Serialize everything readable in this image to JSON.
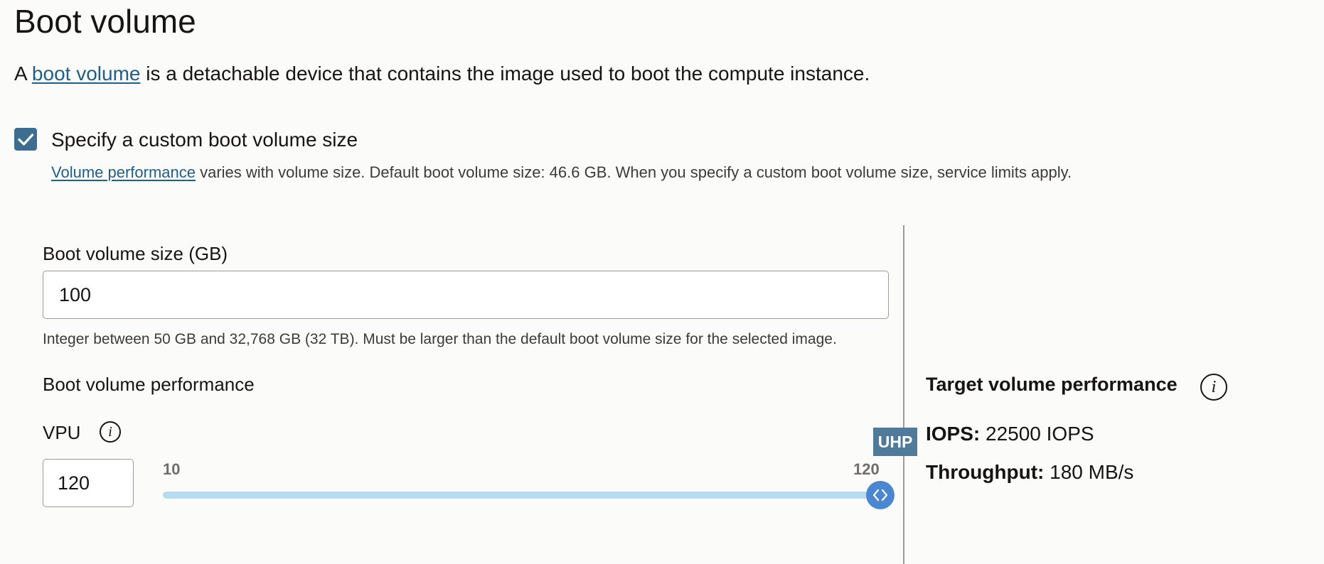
{
  "section": {
    "title": "Boot volume",
    "intro_prefix": "A ",
    "intro_link": "boot volume",
    "intro_suffix": " is a detachable device that contains the image used to boot the compute instance."
  },
  "custom_size": {
    "checkbox_label": "Specify a custom boot volume size",
    "checked": true,
    "help_link": "Volume performance",
    "help_text": " varies with volume size. Default boot volume size: 46.6 GB. When you specify a custom boot volume size, service limits apply."
  },
  "boot_volume_size": {
    "label": "Boot volume size (GB)",
    "value": "100",
    "help": "Integer between 50 GB and 32,768 GB (32 TB). Must be larger than the default boot volume size for the selected image."
  },
  "performance": {
    "heading": "Boot volume performance",
    "vpu_label": "VPU",
    "vpu_value": "120",
    "slider_min": "10",
    "slider_max": "120",
    "slider_value": 120,
    "badge": "UHP"
  },
  "target": {
    "heading": "Target volume performance",
    "iops_label": "IOPS:",
    "iops_value": " 22500 IOPS",
    "throughput_label": "Throughput:",
    "throughput_value": " 180 MB/s"
  },
  "icons": {
    "checkbox": "checkmark-icon",
    "info": "info-icon",
    "slider_handle": "chevrons-left-right-icon"
  },
  "colors": {
    "link": "#1f5f8a",
    "checkbox": "#3d6e8f",
    "slider_track": "#b7dbf0",
    "slider_thumb": "#4b86d0",
    "badge": "#4f7a99"
  }
}
